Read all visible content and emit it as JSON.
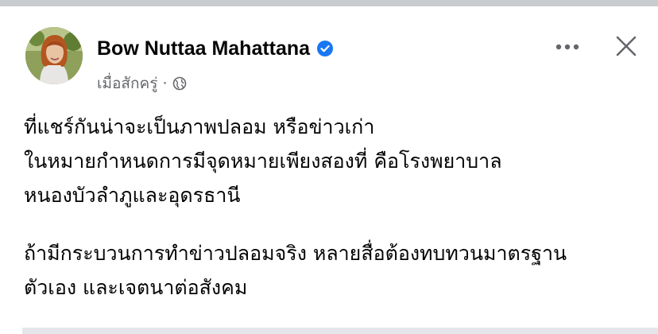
{
  "post": {
    "author": {
      "name": "Bow Nuttaa Mahattana",
      "verified": true,
      "avatar_icon": "profile-photo"
    },
    "timestamp": "เมื่อสักครู่",
    "separator": "·",
    "audience_icon": "globe-icon",
    "actions": {
      "more_icon": "more-horizontal-icon",
      "close_icon": "close-icon"
    },
    "paragraphs": [
      {
        "lines": [
          "ที่แชร์กันน่าจะเป็นภาพปลอม หรือข่าวเก่า",
          "ในหมายกำหนดการมีจุดหมายเพียงสองที่ คือโรงพยาบาล",
          "หนองบัวลำภูและอุดรธานี"
        ]
      },
      {
        "lines": [
          "ถ้ามีกระบวนการทำข่าวปลอมจริง หลายสื่อต้องทบทวนมาตรฐาน",
          "ตัวเอง และเจตนาต่อสังคม"
        ]
      }
    ]
  },
  "colors": {
    "verified_badge": "#1877f2",
    "secondary_text": "#65676b",
    "primary_text": "#050505"
  }
}
